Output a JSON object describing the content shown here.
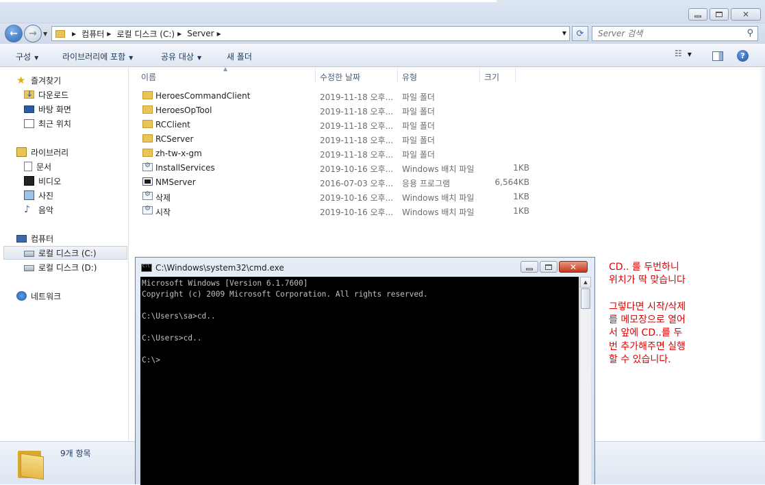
{
  "explorer": {
    "address": {
      "crumbs": [
        "컴퓨터",
        "로컬 디스크 (C:)",
        "Server"
      ]
    },
    "search": {
      "placeholder": "Server 검색"
    },
    "toolbar": {
      "organize": "구성",
      "include_library": "라이브러리에 포함",
      "share": "공유 대상",
      "new_folder": "새 폴더"
    },
    "nav": {
      "favorites": "즐겨찾기",
      "downloads": "다운로드",
      "desktop": "바탕 화면",
      "recent": "최근 위치",
      "libraries": "라이브러리",
      "documents": "문서",
      "videos": "비디오",
      "pictures": "사진",
      "music": "음악",
      "computer": "컴퓨터",
      "disk_c": "로컬 디스크 (C:)",
      "disk_d": "로컬 디스크 (D:)",
      "network": "네트워크"
    },
    "columns": {
      "name": "이름",
      "date": "수정한 날짜",
      "type": "유형",
      "size": "크기"
    },
    "files": [
      {
        "name": "HeroesCommandClient",
        "date": "2019-11-18 오후...",
        "type": "파일 폴더",
        "size": "",
        "icon": "folder-icon"
      },
      {
        "name": "HeroesOpTool",
        "date": "2019-11-18 오후...",
        "type": "파일 폴더",
        "size": "",
        "icon": "folder-icon"
      },
      {
        "name": "RCClient",
        "date": "2019-11-18 오후...",
        "type": "파일 폴더",
        "size": "",
        "icon": "folder-icon"
      },
      {
        "name": "RCServer",
        "date": "2019-11-18 오후...",
        "type": "파일 폴더",
        "size": "",
        "icon": "folder-icon"
      },
      {
        "name": "zh-tw-x-gm",
        "date": "2019-11-18 오후...",
        "type": "파일 폴더",
        "size": "",
        "icon": "folder-icon"
      },
      {
        "name": "InstallServices",
        "date": "2019-10-16 오후...",
        "type": "Windows 배치 파일",
        "size": "1KB",
        "icon": "batch-file-icon"
      },
      {
        "name": "NMServer",
        "date": "2016-07-03 오후...",
        "type": "응용 프로그램",
        "size": "6,564KB",
        "icon": "application-icon"
      },
      {
        "name": "삭제",
        "date": "2019-10-16 오후...",
        "type": "Windows 배치 파일",
        "size": "1KB",
        "icon": "batch-file-icon"
      },
      {
        "name": "시작",
        "date": "2019-10-16 오후...",
        "type": "Windows 배치 파일",
        "size": "1KB",
        "icon": "batch-file-icon"
      }
    ],
    "status": {
      "item_count": "9개 항목"
    }
  },
  "cmd": {
    "title": "C:\\Windows\\system32\\cmd.exe",
    "lines": [
      "Microsoft Windows [Version 6.1.7600]",
      "Copyright (c) 2009 Microsoft Corporation. All rights reserved.",
      "",
      "C:\\Users\\sa>cd..",
      "",
      "C:\\Users>cd..",
      "",
      "C:\\>"
    ]
  },
  "note": {
    "lines": [
      "CD.. 를 두번하니",
      "위치가 딱 맞습니다",
      "",
      "그렇다면 시작/삭제",
      "를 메모장으로 열어",
      "서 앞에 CD..를 두",
      "번 추가해주면 실행",
      "할 수 있습니다."
    ],
    "color": "#e00000"
  }
}
